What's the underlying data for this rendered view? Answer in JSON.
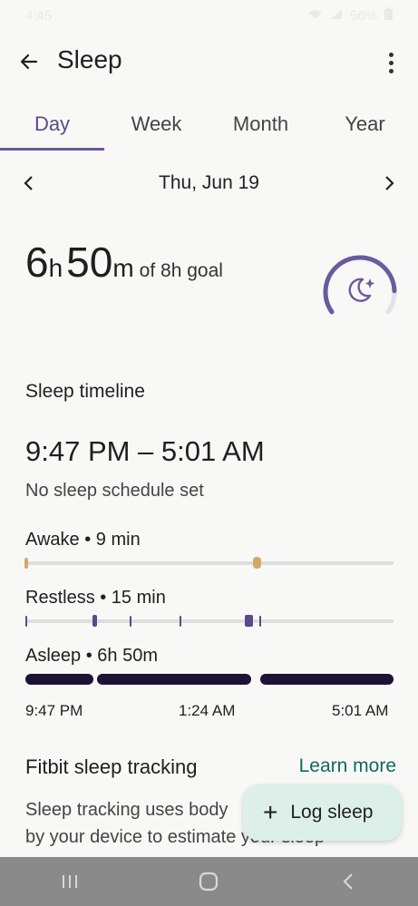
{
  "status_bar": {
    "time": "4:45",
    "battery": "56%"
  },
  "app_bar": {
    "title": "Sleep"
  },
  "tabs": [
    {
      "label": "Day",
      "active": true
    },
    {
      "label": "Week",
      "active": false
    },
    {
      "label": "Month",
      "active": false
    },
    {
      "label": "Year",
      "active": false
    }
  ],
  "date_nav": {
    "date": "Thu, Jun 19"
  },
  "summary": {
    "hours": "6",
    "hours_unit": "h",
    "minutes": "50",
    "minutes_unit": "m",
    "goal_text": "of 8h goal",
    "goal_progress": 0.85,
    "icon": "moon-sparkle-icon"
  },
  "timeline": {
    "section_title": "Sleep timeline",
    "time_range": "9:47 PM – 5:01 AM",
    "schedule_note": "No sleep schedule set",
    "stages": {
      "awake": "Awake • 9 min",
      "restless": "Restless • 15 min",
      "asleep": "Asleep • 6h 50m"
    },
    "axis": {
      "start": "9:47 PM",
      "mid": "1:24 AM",
      "end": "5:01 AM"
    }
  },
  "tracking": {
    "title": "Fitbit sleep tracking",
    "learn_more": "Learn more",
    "description": "Sleep tracking uses body\nby your device to estimate your sleep"
  },
  "fab": {
    "plus": "+",
    "label": "Log sleep"
  },
  "colors": {
    "accent": "#6a5a9e",
    "asleep": "#1e1235",
    "awake": "#d1aa6a",
    "link": "#0f6b5c",
    "fab_bg": "#dcefe9"
  }
}
